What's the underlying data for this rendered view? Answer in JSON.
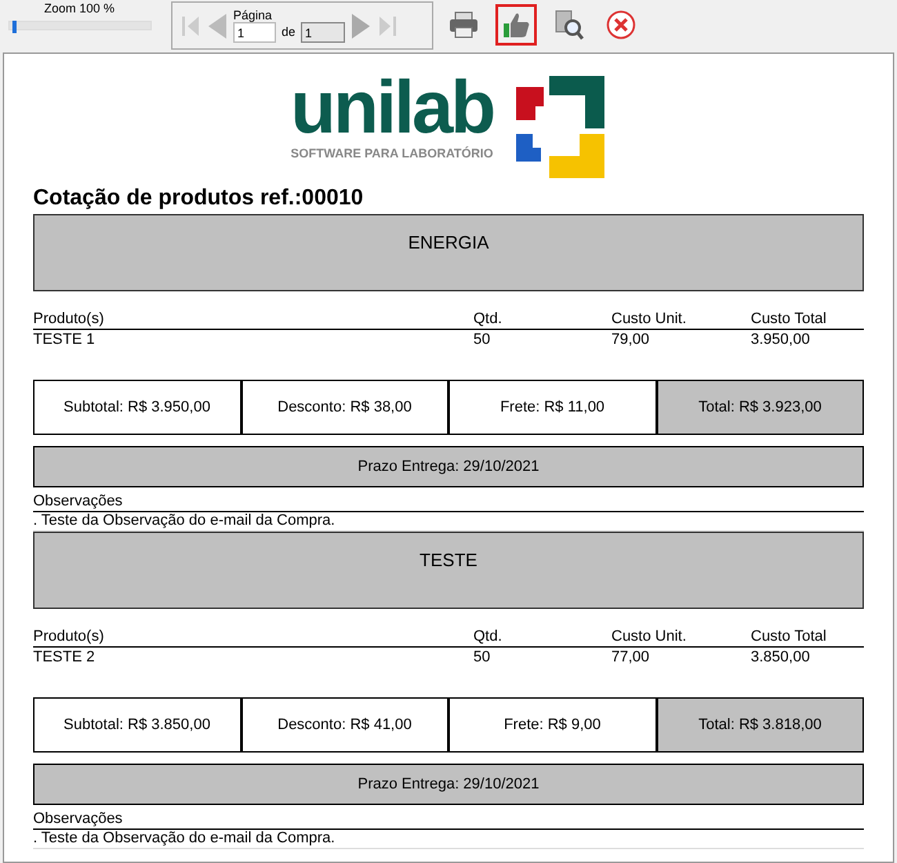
{
  "toolbar": {
    "zoom": {
      "label": "Zoom  100 %",
      "level": 0.02
    },
    "pager": {
      "label": "Página",
      "page": "1",
      "of": "de",
      "total": "1"
    },
    "tools": [
      {
        "kind": "print",
        "selected": false
      },
      {
        "kind": "approve",
        "selected": true
      },
      {
        "kind": "find",
        "selected": false
      },
      {
        "kind": "close",
        "selected": false
      }
    ]
  },
  "logo": {
    "name": "unilab",
    "tagline": "SOFTWARE PARA LABORATÓRIO"
  },
  "title": "Cotação de produtos ref.:00010",
  "sections": [
    {
      "supplier": "ENERGIA",
      "columns": [
        "Produto(s)",
        "Qtd.",
        "Custo Unit.",
        "Custo Total"
      ],
      "rows": [
        [
          "TESTE 1",
          "50",
          "79,00",
          "3.950,00"
        ]
      ],
      "totals": [
        "Subtotal: R$ 3.950,00",
        "Desconto: R$ 38,00",
        "Frete: R$ 11,00",
        "Total: R$ 3.923,00"
      ],
      "delivery": "Prazo Entrega: 29/10/2021",
      "notes_label": "Observações",
      "notes": ". Teste da Observação do e-mail da Compra."
    },
    {
      "supplier": "TESTE",
      "columns": [
        "Produto(s)",
        "Qtd.",
        "Custo Unit.",
        "Custo Total"
      ],
      "rows": [
        [
          "TESTE 2",
          "50",
          "77,00",
          "3.850,00"
        ]
      ],
      "totals": [
        "Subtotal: R$ 3.850,00",
        "Desconto: R$ 41,00",
        "Frete: R$ 9,00",
        "Total: R$ 3.818,00"
      ],
      "delivery": "Prazo Entrega: 29/10/2021",
      "notes_label": "Observações",
      "notes": ". Teste da Observação do e-mail da Compra."
    }
  ]
}
